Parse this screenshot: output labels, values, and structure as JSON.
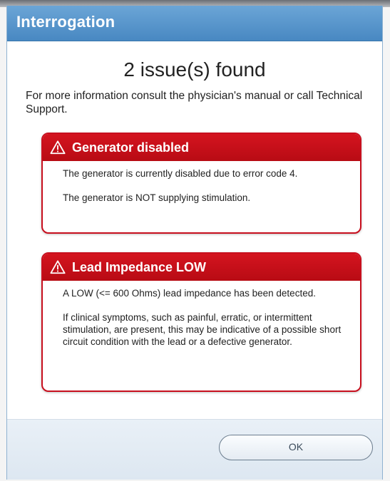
{
  "window": {
    "title": "Interrogation"
  },
  "summary": {
    "headline": "2 issue(s) found",
    "intro": "For more information consult the physician's manual or call Technical Support."
  },
  "alerts": [
    {
      "title": "Generator disabled",
      "icon": "warning-triangle-icon",
      "paragraphs": [
        "The generator is currently disabled due to error code 4.",
        "The generator is NOT supplying stimulation."
      ]
    },
    {
      "title": "Lead Impedance LOW",
      "icon": "warning-triangle-icon",
      "paragraphs": [
        "A LOW (<= 600 Ohms) lead impedance has been detected.",
        "If clinical symptoms, such as painful, erratic, or intermittent stimulation, are present, this may be indicative of a possible short circuit condition with the lead or a defective generator."
      ]
    }
  ],
  "footer": {
    "ok_label": "OK"
  },
  "colors": {
    "title_bar": "#4f8ec8",
    "alert_red": "#c80f1e",
    "footer_bg": "#e4ecf4"
  }
}
